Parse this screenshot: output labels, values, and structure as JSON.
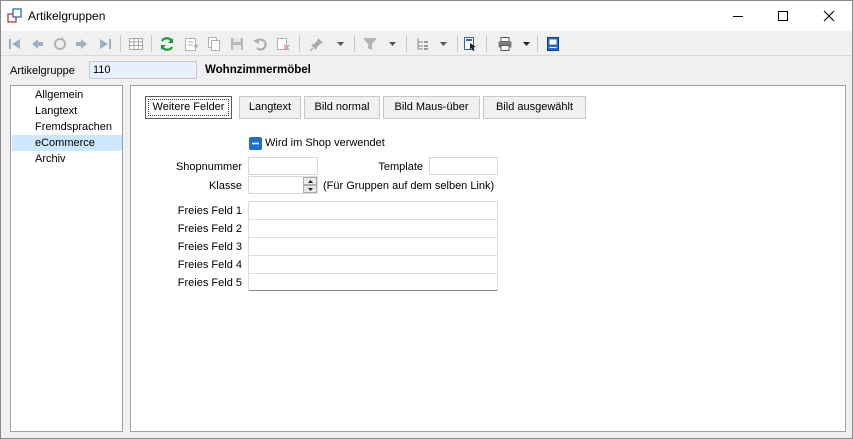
{
  "window": {
    "title": "Artikelgruppen",
    "minimize_icon": "minimize-icon",
    "maximize_icon": "maximize-icon",
    "close_icon": "close-icon"
  },
  "toolbar": {
    "icons": [
      "first-record-icon",
      "previous-record-icon",
      "go-to-icon",
      "next-record-icon",
      "last-record-icon",
      "table-view-icon",
      "refresh-icon",
      "new-record-icon",
      "copy-record-icon",
      "save-icon",
      "undo-icon",
      "delete-icon",
      "pin-icon",
      "filter-icon",
      "tree-icon",
      "export-icon",
      "print-icon",
      "book-icon"
    ]
  },
  "header": {
    "label": "Artikelgruppe",
    "value": "110",
    "name": "Wohnzimmermöbel"
  },
  "nav": {
    "items": [
      {
        "label": "Allgemein",
        "active": false
      },
      {
        "label": "Langtext",
        "active": false
      },
      {
        "label": "Fremdsprachen",
        "active": false
      },
      {
        "label": "eCommerce",
        "active": true
      },
      {
        "label": "Archiv",
        "active": false
      }
    ]
  },
  "tabs": [
    {
      "label": "Weitere Felder",
      "active": true
    },
    {
      "label": "Langtext",
      "active": false
    },
    {
      "label": "Bild normal",
      "active": false
    },
    {
      "label": "Bild Maus-über",
      "active": false
    },
    {
      "label": "Bild ausgewählt",
      "active": false
    }
  ],
  "form": {
    "shop_checkbox_label": "Wird im Shop verwendet",
    "shop_checked": true,
    "shopnummer_label": "Shopnummer",
    "shopnummer_value": "",
    "template_label": "Template",
    "template_value": "",
    "klasse_label": "Klasse",
    "klasse_value": "",
    "klasse_hint": "(Für Gruppen auf dem selben Link)",
    "free_fields": [
      {
        "label": "Freies Feld 1",
        "value": ""
      },
      {
        "label": "Freies Feld 2",
        "value": ""
      },
      {
        "label": "Freies Feld 3",
        "value": ""
      },
      {
        "label": "Freies Feld 4",
        "value": ""
      },
      {
        "label": "Freies Feld 5",
        "value": ""
      }
    ]
  },
  "colors": {
    "selection": "#cce8ff",
    "checkbox": "#1e6fc8",
    "accent_blue": "#1e6fc8",
    "refresh_green": "#1a9a3a"
  }
}
